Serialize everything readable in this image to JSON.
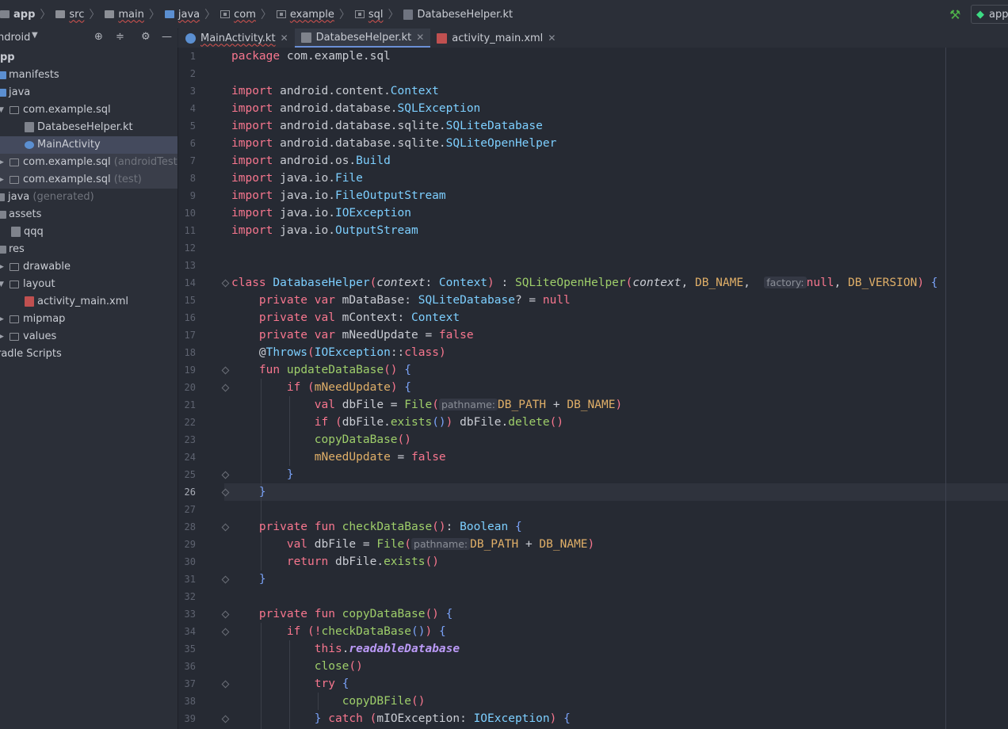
{
  "breadcrumb": [
    "app",
    "src",
    "main",
    "java",
    "com",
    "example",
    "sql",
    "DatabeseHelper.kt"
  ],
  "run_config": "app",
  "project_panel": {
    "title": "ndroid"
  },
  "tree": [
    {
      "label": "pp",
      "note": ""
    },
    {
      "label": "manifests",
      "note": ""
    },
    {
      "label": "java",
      "note": ""
    },
    {
      "label": "com.example.sql",
      "note": ""
    },
    {
      "label": "DatabeseHelper.kt",
      "note": ""
    },
    {
      "label": "MainActivity",
      "note": ""
    },
    {
      "label": "com.example.sql",
      "note": "(androidTest)"
    },
    {
      "label": "com.example.sql",
      "note": "(test)"
    },
    {
      "label": "java",
      "note": "(generated)"
    },
    {
      "label": "assets",
      "note": ""
    },
    {
      "label": "qqq",
      "note": ""
    },
    {
      "label": "res",
      "note": ""
    },
    {
      "label": "drawable",
      "note": ""
    },
    {
      "label": "layout",
      "note": ""
    },
    {
      "label": "activity_main.xml",
      "note": ""
    },
    {
      "label": "mipmap",
      "note": ""
    },
    {
      "label": "values",
      "note": ""
    },
    {
      "label": "radle Scripts",
      "note": ""
    }
  ],
  "tabs": [
    {
      "label": "MainActivity.kt"
    },
    {
      "label": "DatabeseHelper.kt"
    },
    {
      "label": "activity_main.xml"
    }
  ],
  "line_numbers": [
    "1",
    "2",
    "3",
    "4",
    "5",
    "6",
    "7",
    "8",
    "9",
    "10",
    "11",
    "12",
    "13",
    "14",
    "15",
    "16",
    "17",
    "18",
    "19",
    "20",
    "21",
    "22",
    "23",
    "24",
    "25",
    "26",
    "27",
    "28",
    "29",
    "30",
    "31",
    "32",
    "33",
    "34",
    "35",
    "36",
    "37",
    "38",
    "39"
  ],
  "code": {
    "l1_kw": "package",
    "l1_rest": " com.example.sql",
    "imp": "import",
    "l3a": " android.content.",
    "l3b": "Context",
    "l4a": " android.database.",
    "l4b": "SQLException",
    "l5a": " android.database.sqlite.",
    "l5b": "SQLiteDatabase",
    "l6a": " android.database.sqlite.",
    "l6b": "SQLiteOpenHelper",
    "l7a": " android.os.",
    "l7b": "Build",
    "l8a": " java.io.",
    "l8b": "File",
    "l9a": " java.io.",
    "l9b": "FileOutputStream",
    "l10a": " java.io.",
    "l10b": "IOException",
    "l11a": " java.io.",
    "l11b": "OutputStream",
    "l14": {
      "kw": "class",
      "name": "DatabaseHelper",
      "p1": "(",
      "param": "context",
      "colon": ": ",
      "type": "Context",
      "p2": ")",
      "ext": " : ",
      "sup": "SQLiteOpenHelper",
      "p3": "(",
      "param2": "context",
      "comma": ", ",
      "c1": "DB_NAME",
      "comma2": ",  ",
      "hint": "factory:",
      "null": "null",
      "comma3": ", ",
      "c2": "DB_VERSION",
      "p4": ")",
      "brace": " {"
    },
    "l15": {
      "kw": "private var",
      "name": " mDataBase: ",
      "type": "SQLiteDatabase",
      "rest": "? = ",
      "null": "null"
    },
    "l16": {
      "kw": "private val",
      "name": " mContext: ",
      "type": "Context"
    },
    "l17": {
      "kw": "private var",
      "name": " mNeedUpdate = ",
      "val": "false"
    },
    "l18": {
      "at": "@",
      "ann": "Throws",
      "p": "(",
      "type": "IOException",
      "rest": "::",
      "cls": "class",
      "p2": ")"
    },
    "l19": {
      "kw": "fun",
      "name": " updateDataBase",
      "p": "()",
      "brace": " {"
    },
    "l20": {
      "kw": "if",
      "p": " (",
      "name": "mNeedUpdate",
      "p2": ")",
      "brace": " {"
    },
    "l21": {
      "kw": "val",
      "name": " dbFile = ",
      "fn": "File",
      "p": "(",
      "hint": "pathname:",
      "c1": "DB_PATH",
      "plus": " + ",
      "c2": "DB_NAME",
      "p2": ")"
    },
    "l22": {
      "kw": "if",
      "p": " (",
      "name": "dbFile.",
      "fn": "exists",
      "pp": "()",
      "p2": ")",
      "rest": " dbFile.",
      "fn2": "delete",
      "pp2": "()"
    },
    "l23": {
      "fn": "copyDataBase",
      "p": "()"
    },
    "l24": {
      "name": "mNeedUpdate",
      "eq": " = ",
      "val": "false"
    },
    "l25": "}",
    "l26": "}",
    "l28": {
      "kw": "private fun",
      "name": " checkDataBase",
      "p": "()",
      "colon": ": ",
      "type": "Boolean",
      "brace": " {"
    },
    "l29": {
      "kw": "val",
      "name": " dbFile = ",
      "fn": "File",
      "p": "(",
      "hint": "pathname:",
      "c1": "DB_PATH",
      "plus": " + ",
      "c2": "DB_NAME",
      "p2": ")"
    },
    "l30": {
      "kw": "return",
      "name": " dbFile.",
      "fn": "exists",
      "p": "()"
    },
    "l31": "}",
    "l33": {
      "kw": "private fun",
      "name": " copyDataBase",
      "p": "()",
      "brace": " {"
    },
    "l34": {
      "kw": "if",
      "p": " (!",
      "fn": "checkDataBase",
      "pp": "()",
      "p2": ")",
      "brace": " {"
    },
    "l35": {
      "kw": "this",
      "dot": ".",
      "prop": "readableDatabase"
    },
    "l36": {
      "fn": "close",
      "p": "()"
    },
    "l37": {
      "kw": "try",
      "brace": " {"
    },
    "l38": {
      "fn": "copyDBFile",
      "p": "()"
    },
    "l39": {
      "b": "}",
      "kw": " catch",
      "p": " (",
      "name": "mIOException: ",
      "type": "IOException",
      "p2": ")",
      "brace": " {"
    }
  }
}
